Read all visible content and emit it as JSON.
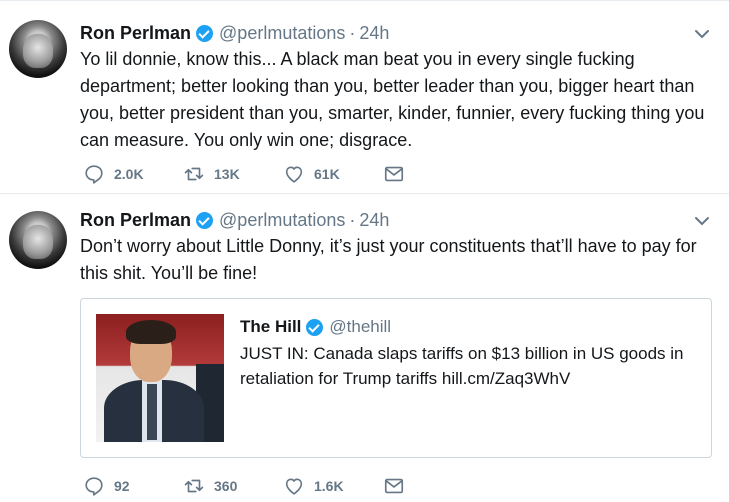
{
  "tweets": [
    {
      "author_name": "Ron Perlman",
      "handle": "@perlmutations",
      "separator": "·",
      "time": "24h",
      "text": "Yo lil donnie, know this... A black man beat you in every single fucking department; better looking than you, better leader than you, bigger heart than you, better president than you, smarter, kinder, funnier, every fucking thing you can measure. You only win one; disgrace.",
      "reply_count": "2.0K",
      "retweet_count": "13K",
      "like_count": "61K"
    },
    {
      "author_name": "Ron Perlman",
      "handle": "@perlmutations",
      "separator": "·",
      "time": "24h",
      "text": "Don’t worry about Little Donny, it’s just your constituents that’ll have to pay for this shit. You’ll be fine!",
      "quote": {
        "author_name": "The Hill",
        "handle": "@thehill",
        "text": "JUST IN: Canada slaps tariffs on $13 billion in US goods in retaliation for Trump tariffs hill.cm/Zaq3WhV"
      },
      "reply_count": "92",
      "retweet_count": "360",
      "like_count": "1.6K"
    }
  ],
  "icons": {
    "reply": "reply-icon",
    "retweet": "retweet-icon",
    "like": "heart-icon",
    "dm": "envelope-icon",
    "verified": "verified-badge-icon",
    "menu": "chevron-down-icon"
  },
  "colors": {
    "verified": "#1da1f2",
    "secondary_text": "#657786",
    "border": "#e6ecf0"
  }
}
